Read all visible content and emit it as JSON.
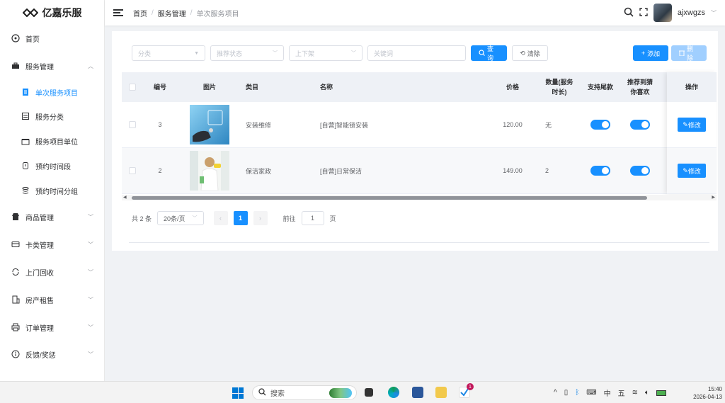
{
  "app": {
    "logo_text": "亿嘉乐服"
  },
  "colors": {
    "primary": "#1890ff",
    "sidebar_bg": "#ffffff",
    "page_bg": "#f0f2f5"
  },
  "sidebar": {
    "items": [
      {
        "label": "首页",
        "icon": "dashboard-icon"
      },
      {
        "label": "服务管理",
        "icon": "briefcase-icon",
        "expanded": true
      },
      {
        "label": "单次服务项目",
        "icon": "document-icon",
        "active": true
      },
      {
        "label": "服务分类",
        "icon": "category-icon"
      },
      {
        "label": "服务项目单位",
        "icon": "box-icon"
      },
      {
        "label": "预约时间段",
        "icon": "clock-icon"
      },
      {
        "label": "预约时间分组",
        "icon": "stack-icon"
      },
      {
        "label": "商品管理",
        "icon": "shop-icon"
      },
      {
        "label": "卡类管理",
        "icon": "card-icon"
      },
      {
        "label": "上门回收",
        "icon": "recycle-icon"
      },
      {
        "label": "房产租售",
        "icon": "building-icon"
      },
      {
        "label": "订单管理",
        "icon": "printer-icon"
      },
      {
        "label": "反馈/奖惩",
        "icon": "info-icon"
      }
    ]
  },
  "header": {
    "breadcrumb": [
      "首页",
      "服务管理",
      "单次服务项目"
    ],
    "username": "ajxwgzs"
  },
  "filters": {
    "category_placeholder": "分类",
    "recommend_placeholder": "推荐状态",
    "shelf_placeholder": "上下架",
    "keyword_placeholder": "关键词",
    "search_label": "查询",
    "clear_label": "清除",
    "add_label": "添加",
    "delete_label": "删除"
  },
  "table": {
    "columns": [
      "编号",
      "图片",
      "类目",
      "名称",
      "价格",
      "数量(服务",
      "时长)",
      "支持尾款",
      "推荐到猜",
      "你喜欢",
      "操作"
    ],
    "rows": [
      {
        "id": "3",
        "category": "安装维修",
        "name": "[自营]智能锁安装",
        "price": "120.00",
        "qty": "无",
        "support_balance": true,
        "recommend": true,
        "edit_label": "修改"
      },
      {
        "id": "2",
        "category": "保洁家政",
        "name": "[自营]日常保洁",
        "price": "149.00",
        "qty": "2",
        "support_balance": true,
        "recommend": true,
        "edit_label": "修改"
      }
    ]
  },
  "pagination": {
    "total_text": "共 2 条",
    "page_size": "20条/页",
    "current_page": "1",
    "goto_prefix": "前往",
    "goto_value": "1",
    "goto_suffix": "页"
  },
  "taskbar": {
    "search_placeholder": "搜索",
    "ime_lang": "中",
    "ime_mode": "五",
    "time": "15:40",
    "date": "2026-04-13",
    "badge": "1"
  }
}
